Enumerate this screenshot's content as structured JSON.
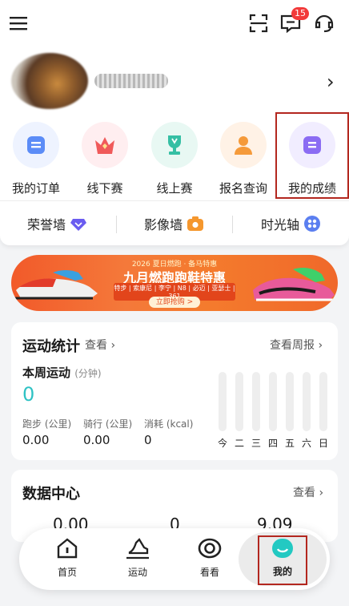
{
  "topbar": {
    "menu_icon": "menu-icon",
    "scan_icon": "scan-icon",
    "message_icon": "message-icon",
    "message_badge": "15",
    "support_icon": "headset-icon"
  },
  "quick_actions": [
    {
      "label": "我的订单",
      "icon": "order-icon",
      "color": "#5b8cf7"
    },
    {
      "label": "线下赛",
      "icon": "crown-icon",
      "color": "#f05a5a"
    },
    {
      "label": "线上赛",
      "icon": "trophy-icon",
      "color": "#35bfa4"
    },
    {
      "label": "报名查询",
      "icon": "person-icon",
      "color": "#f59a3a"
    },
    {
      "label": "我的成绩",
      "icon": "score-icon",
      "color": "#8b6cf3"
    }
  ],
  "walls": [
    {
      "label": "荣誉墙",
      "icon": "diamond-icon"
    },
    {
      "label": "影像墙",
      "icon": "camera-icon"
    },
    {
      "label": "时光轴",
      "icon": "grid-icon"
    }
  ],
  "banner": {
    "line1": "2026 夏日燃跑 · 备马特惠",
    "line2": "九月燃跑跑鞋特惠",
    "line3": "特步 | 索康尼 | 李宁 | N8 | 必迈 | 亚瑟士 | 361",
    "cta": "立即抢购 >"
  },
  "stats": {
    "title": "运动统计",
    "view": "查看",
    "weekly": "查看周报",
    "week_label": "本周运动",
    "week_unit": "(分钟)",
    "week_value": "0",
    "metrics": [
      {
        "label": "跑步 (公里)",
        "value": "0.00"
      },
      {
        "label": "骑行 (公里)",
        "value": "0.00"
      },
      {
        "label": "消耗 (kcal)",
        "value": "0"
      }
    ],
    "days": [
      "今",
      "二",
      "三",
      "四",
      "五",
      "六",
      "日"
    ]
  },
  "data_center": {
    "title": "数据中心",
    "view": "查看",
    "values": [
      "0.00",
      "0",
      "9.09"
    ]
  },
  "nav": [
    {
      "label": "首页",
      "icon": "home-icon"
    },
    {
      "label": "运动",
      "icon": "sport-icon"
    },
    {
      "label": "看看",
      "icon": "eye-icon"
    },
    {
      "label": "我的",
      "icon": "profile-icon"
    }
  ]
}
